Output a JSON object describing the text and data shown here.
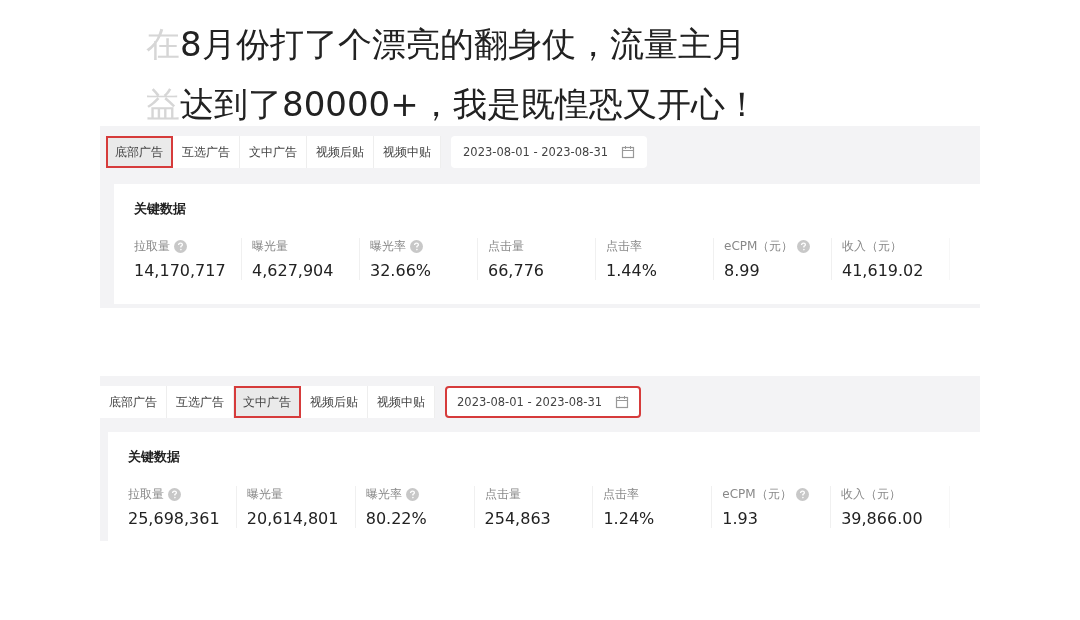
{
  "article": {
    "lines": [
      {
        "faded": "在",
        "text": "8月份打了个漂亮的翻身仗，流量主月"
      },
      {
        "faded": "益",
        "text": "达到了80000+，我是既惶恐又开心！"
      }
    ]
  },
  "panels": [
    {
      "tabs": [
        {
          "label": "底部广告",
          "selected": true
        },
        {
          "label": "互选广告",
          "selected": false
        },
        {
          "label": "文中广告",
          "selected": false
        },
        {
          "label": "视频后贴",
          "selected": false
        },
        {
          "label": "视频中贴",
          "selected": false
        }
      ],
      "date_range": {
        "value": "2023-08-01 - 2023-08-31",
        "highlighted": false
      },
      "section_title": "关键数据",
      "metrics": [
        {
          "label": "拉取量",
          "help": true,
          "value": "14,170,717"
        },
        {
          "label": "曝光量",
          "help": false,
          "value": "4,627,904"
        },
        {
          "label": "曝光率",
          "help": true,
          "value": "32.66%"
        },
        {
          "label": "点击量",
          "help": false,
          "value": "66,776"
        },
        {
          "label": "点击率",
          "help": false,
          "value": "1.44%"
        },
        {
          "label": "eCPM（元）",
          "help": true,
          "value": "8.99"
        },
        {
          "label": "收入（元）",
          "help": false,
          "value": "41,619.02"
        }
      ]
    },
    {
      "tabs": [
        {
          "label": "底部广告",
          "selected": false
        },
        {
          "label": "互选广告",
          "selected": false
        },
        {
          "label": "文中广告",
          "selected": true
        },
        {
          "label": "视频后贴",
          "selected": false
        },
        {
          "label": "视频中贴",
          "selected": false
        }
      ],
      "date_range": {
        "value": "2023-08-01 - 2023-08-31",
        "highlighted": true
      },
      "section_title": "关键数据",
      "metrics": [
        {
          "label": "拉取量",
          "help": true,
          "value": "25,698,361"
        },
        {
          "label": "曝光量",
          "help": false,
          "value": "20,614,801"
        },
        {
          "label": "曝光率",
          "help": true,
          "value": "80.22%"
        },
        {
          "label": "点击量",
          "help": false,
          "value": "254,863"
        },
        {
          "label": "点击率",
          "help": false,
          "value": "1.24%"
        },
        {
          "label": "eCPM（元）",
          "help": true,
          "value": "1.93"
        },
        {
          "label": "收入（元）",
          "help": false,
          "value": "39,866.00"
        }
      ]
    }
  ]
}
